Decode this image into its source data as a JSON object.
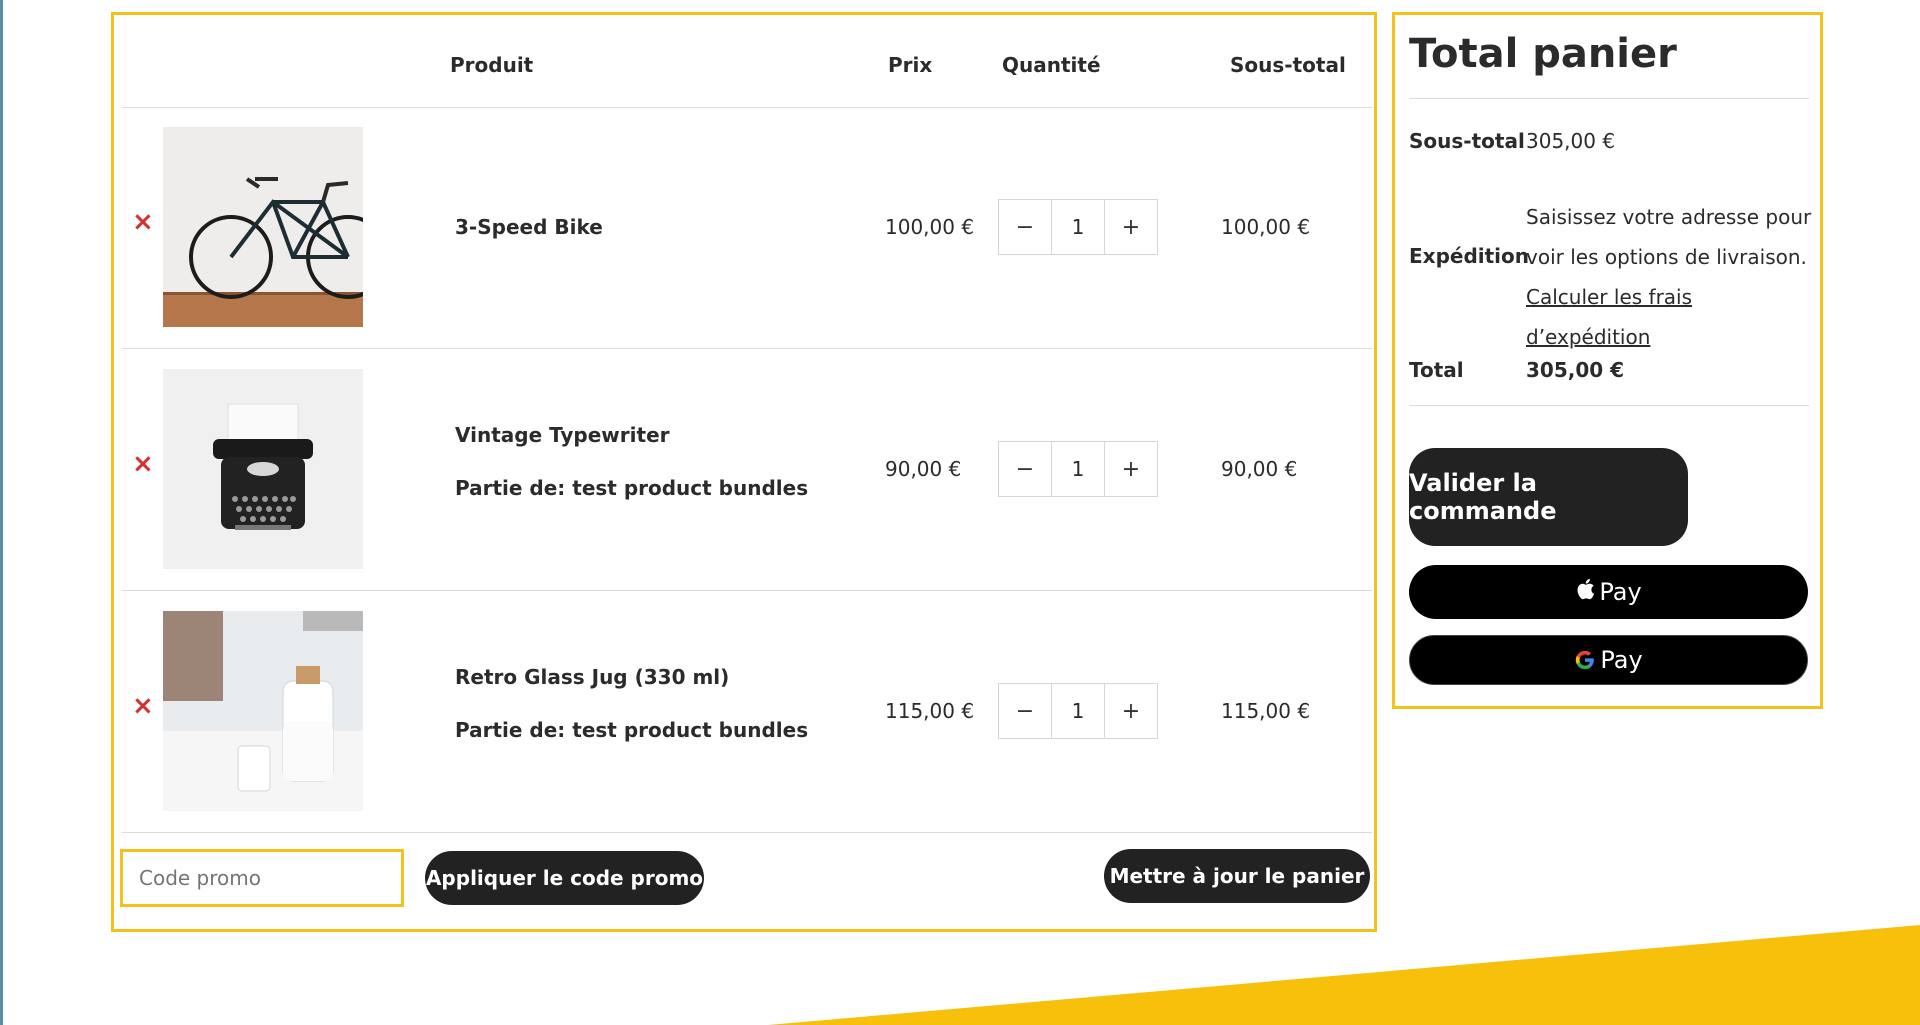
{
  "cart": {
    "headers": {
      "product": "Produit",
      "price": "Prix",
      "quantity": "Quantité",
      "subtotal": "Sous-total"
    },
    "items": [
      {
        "name": "3-Speed Bike",
        "bundle": "",
        "price": "100,00 €",
        "qty": "1",
        "subtotal": "100,00 €",
        "remove": "×",
        "image": "bicycle"
      },
      {
        "name": "Vintage Typewriter",
        "bundle": "Partie de: test product bundles",
        "price": "90,00 €",
        "qty": "1",
        "subtotal": "90,00 €",
        "remove": "×",
        "image": "typewriter"
      },
      {
        "name": "Retro Glass Jug (330 ml)",
        "bundle": "Partie de: test product bundles",
        "price": "115,00 €",
        "qty": "1",
        "subtotal": "115,00 €",
        "remove": "×",
        "image": "glass-jug"
      }
    ],
    "qty_minus": "−",
    "qty_plus": "+",
    "coupon_placeholder": "Code promo",
    "apply_coupon": "Appliquer le code promo",
    "update_cart": "Mettre à jour le panier"
  },
  "totals": {
    "title": "Total panier",
    "subtotal_label": "Sous-total",
    "subtotal_value": "305,00 €",
    "shipping_label": "Expédition",
    "shipping_text": "Saisissez votre adresse pour voir les options de livraison.",
    "shipping_link": "Calculer les frais d’expédition",
    "total_label": "Total",
    "total_value": "305,00 €",
    "checkout": "Valider la commande",
    "apple_pay": "Pay",
    "google_pay": "Pay"
  },
  "colors": {
    "accent": "#f3c21b",
    "button": "#222222",
    "remove": "#d4302f"
  }
}
